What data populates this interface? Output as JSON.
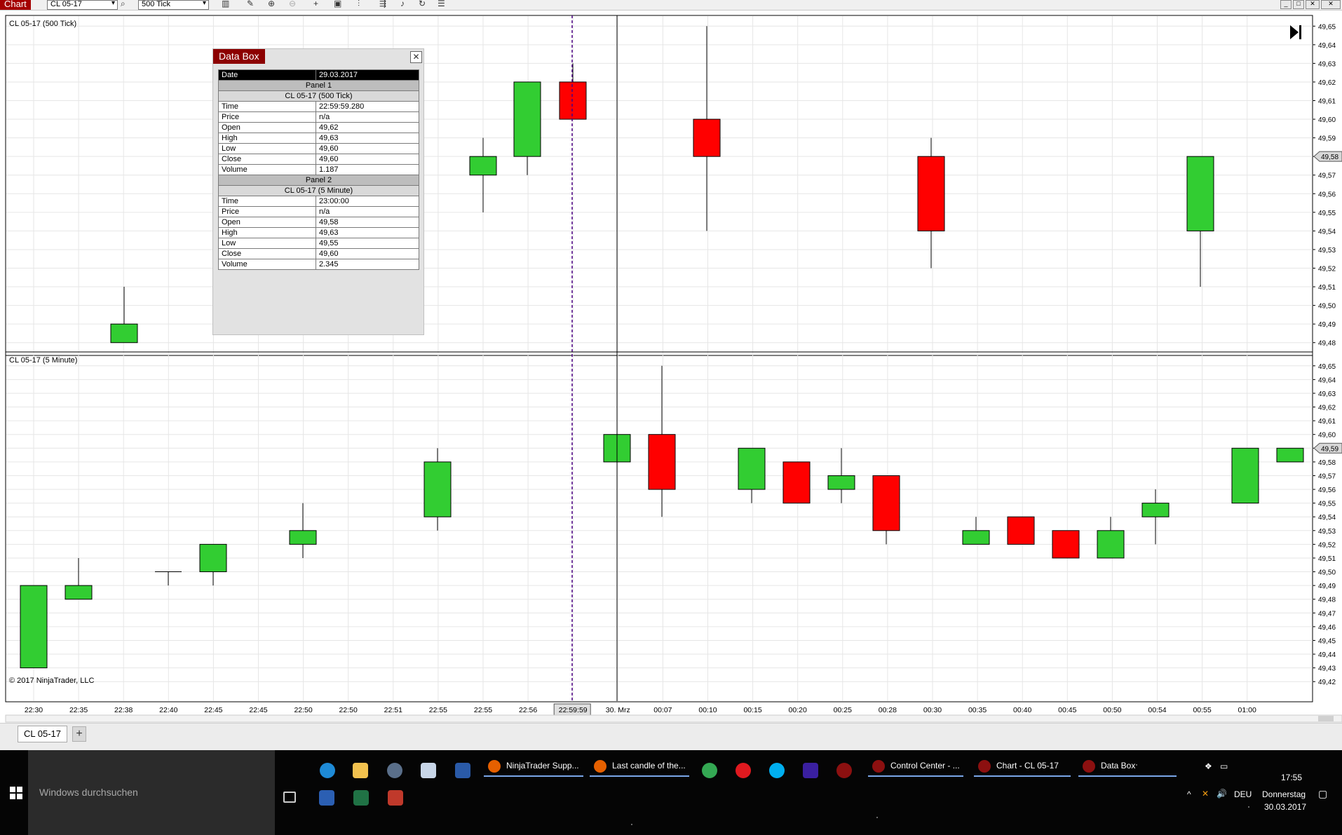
{
  "toolbar": {
    "chart_tab": "Chart",
    "instrument": "CL 05-17",
    "interval": "500 Tick"
  },
  "panels": [
    {
      "title": "CL 05-17 (500 Tick)",
      "price_axis": [
        "49,65",
        "49,64",
        "49,63",
        "49,62",
        "49,61",
        "49,60",
        "49,59",
        "49,58",
        "49,57",
        "49,56",
        "49,55",
        "49,54",
        "49,53",
        "49,52",
        "49,51",
        "49,50",
        "49,49",
        "49,48"
      ],
      "current_price": "49,58"
    },
    {
      "title": "CL 05-17 (5 Minute)",
      "price_axis": [
        "49,65",
        "49,64",
        "49,63",
        "49,62",
        "49,61",
        "49,60",
        "49,59",
        "49,58",
        "49,57",
        "49,56",
        "49,55",
        "49,54",
        "49,53",
        "49,52",
        "49,51",
        "49,50",
        "49,49",
        "49,48",
        "49,47",
        "49,46",
        "49,45",
        "49,44",
        "49,43",
        "49,42"
      ],
      "current_price": "49,59"
    }
  ],
  "time_axis": [
    "22:30",
    "22:35",
    "22:38",
    "22:40",
    "22:45",
    "22:45",
    "22:50",
    "22:50",
    "22:51",
    "22:55",
    "22:55",
    "22:56",
    "22:59:59",
    "30. Mrz",
    "00:07",
    "00:10",
    "00:15",
    "00:20",
    "00:25",
    "00:28",
    "00:30",
    "00:35",
    "00:40",
    "00:45",
    "00:50",
    "00:54",
    "00:55",
    "01:00"
  ],
  "chart_data": [
    {
      "type": "candlestick",
      "title": "CL 05-17 (500 Tick)",
      "x": [
        "22:38",
        "22:55",
        "22:56",
        "22:56",
        "00:07",
        "00:28",
        "00:54"
      ],
      "open": [
        49.48,
        49.57,
        49.58,
        49.62,
        49.6,
        49.58,
        49.54
      ],
      "high": [
        49.51,
        49.59,
        49.62,
        49.63,
        49.65,
        49.59,
        49.58
      ],
      "low": [
        49.48,
        49.55,
        49.57,
        49.6,
        49.54,
        49.52,
        49.51
      ],
      "close": [
        49.49,
        49.58,
        49.62,
        49.6,
        49.58,
        49.54,
        49.58
      ],
      "ylim": [
        49.475,
        49.655
      ]
    },
    {
      "type": "candlestick",
      "title": "CL 05-17 (5 Minute)",
      "x": [
        "22:30",
        "22:35",
        "22:40",
        "22:45",
        "22:50",
        "22:55",
        "23:00",
        "23:05",
        "00:10",
        "00:15",
        "00:20",
        "00:25",
        "00:30",
        "00:35",
        "00:40",
        "00:45",
        "00:50",
        "00:55",
        "01:00"
      ],
      "open": [
        49.43,
        49.48,
        49.5,
        49.5,
        49.52,
        49.54,
        49.58,
        49.6,
        49.56,
        49.58,
        49.56,
        49.57,
        49.52,
        49.54,
        49.53,
        49.51,
        49.54,
        49.55,
        49.58
      ],
      "high": [
        49.49,
        49.51,
        49.5,
        49.52,
        49.55,
        49.59,
        49.6,
        49.65,
        49.59,
        49.58,
        49.59,
        49.57,
        49.54,
        49.54,
        49.53,
        49.54,
        49.56,
        49.59,
        49.59
      ],
      "low": [
        49.43,
        49.48,
        49.49,
        49.49,
        49.51,
        49.53,
        49.58,
        49.54,
        49.55,
        49.55,
        49.55,
        49.52,
        49.52,
        49.52,
        49.51,
        49.51,
        49.52,
        49.55,
        49.58
      ],
      "close": [
        49.49,
        49.49,
        49.5,
        49.52,
        49.53,
        49.58,
        49.6,
        49.56,
        49.59,
        49.55,
        49.57,
        49.53,
        49.53,
        49.52,
        49.51,
        49.53,
        49.55,
        49.59,
        49.59
      ],
      "ylim": [
        49.415,
        49.655
      ]
    }
  ],
  "databox": {
    "title": "Data Box",
    "date_label": "Date",
    "date_value": "29.03.2017",
    "panel1": {
      "section": "Panel 1",
      "series": "CL 05-17 (500 Tick)",
      "rows": [
        {
          "k": "Time",
          "v": "22:59:59.280"
        },
        {
          "k": "Price",
          "v": "n/a"
        },
        {
          "k": "Open",
          "v": "49,62"
        },
        {
          "k": "High",
          "v": "49,63"
        },
        {
          "k": "Low",
          "v": "49,60"
        },
        {
          "k": "Close",
          "v": "49,60"
        },
        {
          "k": "Volume",
          "v": "1.187"
        }
      ]
    },
    "panel2": {
      "section": "Panel 2",
      "series": "CL 05-17 (5 Minute)",
      "rows": [
        {
          "k": "Time",
          "v": "23:00:00"
        },
        {
          "k": "Price",
          "v": "n/a"
        },
        {
          "k": "Open",
          "v": "49,58"
        },
        {
          "k": "High",
          "v": "49,63"
        },
        {
          "k": "Low",
          "v": "49,55"
        },
        {
          "k": "Close",
          "v": "49,60"
        },
        {
          "k": "Volume",
          "v": "2.345"
        }
      ]
    }
  },
  "copyright": "© 2017 NinjaTrader, LLC",
  "tabstrip": {
    "tab": "CL 05-17",
    "add": "+"
  },
  "taskbar": {
    "search_placeholder": "Windows durchsuchen",
    "apps": [
      "NinjaTrader Supp...",
      "Last candle of the...",
      "Control Center - ...",
      "Chart - CL 05-17",
      "Data Box"
    ],
    "time": "17:55",
    "day": "Donnerstag",
    "date": "30.03.2017",
    "lang": "DEU"
  },
  "colors": {
    "up": "#32cd32",
    "down": "#ff0000",
    "crosshair_dashed": "#4b0082"
  }
}
